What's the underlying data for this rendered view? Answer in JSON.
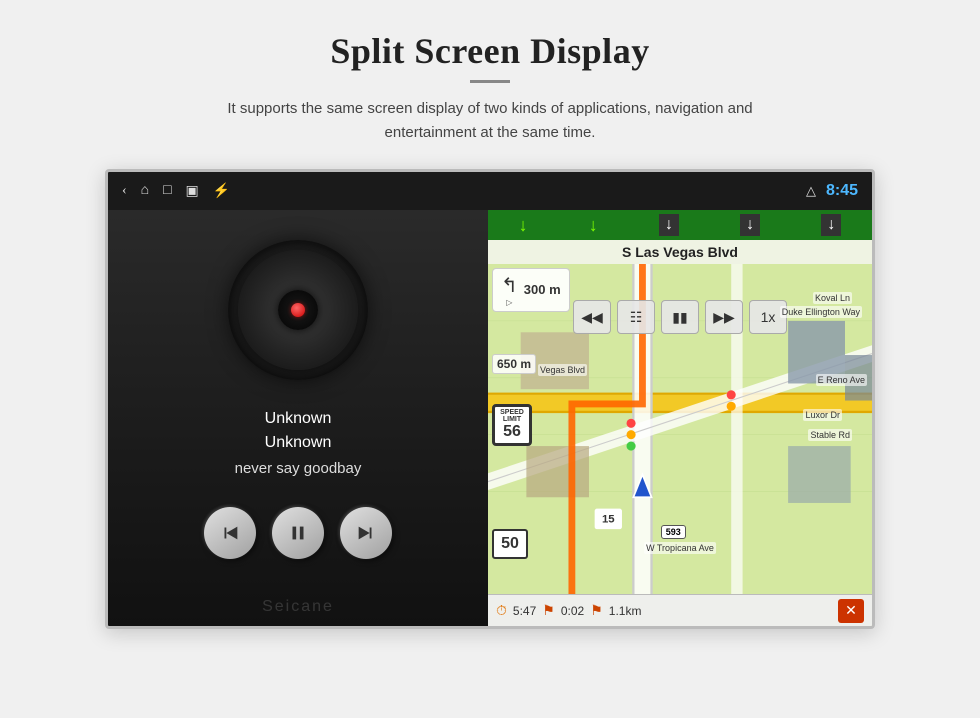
{
  "header": {
    "title": "Split Screen Display",
    "divider": true,
    "subtitle": "It supports the same screen display of two kinds of applications, navigation and entertainment at the same time."
  },
  "status_bar": {
    "time": "8:45",
    "icons": {
      "back": "‹",
      "home": "⌂",
      "square": "▢",
      "image": "▣",
      "usb": "⚡",
      "triangle": "△"
    }
  },
  "music_panel": {
    "artist": "Unknown",
    "album": "Unknown",
    "track": "never say goodbay",
    "controls": {
      "prev": "prev",
      "play_pause": "pause",
      "next": "next"
    }
  },
  "nav_panel": {
    "street": "S Las Vegas Blvd",
    "turn_distance": "300 m",
    "distance_to_next": "650 m",
    "speed_limit": "56",
    "speed_display": "50",
    "time_elapsed": "5:47",
    "route_time": "0:02",
    "distance_remaining": "1.1km",
    "controls": {
      "skip_back": "⏮",
      "grid": "⊞",
      "pause": "⏸",
      "skip_fwd": "⏭",
      "speed": "1x"
    },
    "road_labels": [
      "Koval Ln",
      "Duke Ellington Way",
      "Vegas Blvd",
      "Luxor Dr",
      "Stable Rd",
      "E Reno Ave",
      "W Tropicana Ave"
    ],
    "route_593": "593",
    "route_15": "15",
    "watermark": "Seicane"
  }
}
